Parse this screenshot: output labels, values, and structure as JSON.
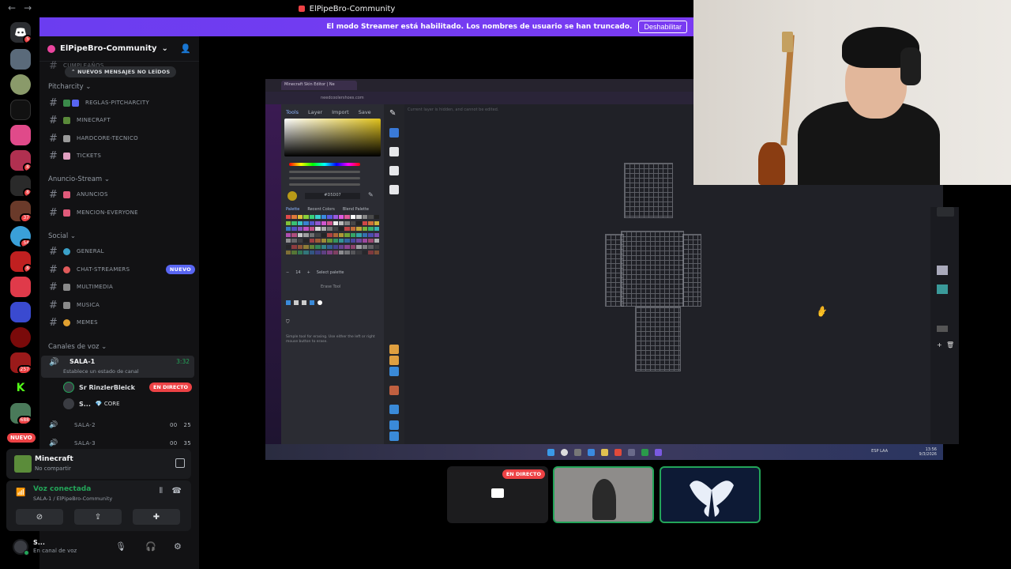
{
  "window": {
    "title": "ElPipeBro-Community",
    "back_glyph": "←",
    "fwd_glyph": "→"
  },
  "banner": {
    "text": "El modo Streamer está habilitado. Los nombres de usuario se han truncado.",
    "button": "Deshabilitar"
  },
  "rail": {
    "badges": [
      "5",
      "8",
      "8",
      "37",
      "54",
      "8",
      "257",
      "688"
    ],
    "nuevo": "NUEVO",
    "discord_icon": "discord-logo-icon"
  },
  "guild": {
    "name": "ElPipeBro-Community"
  },
  "unread_pill": "NUEVOS MENSAJES NO LEÍDOS",
  "partial_top_channel": "CUMPLEAÑOS",
  "categories": {
    "pitcharcity": "Pitcharcity",
    "anuncio": "Anuncio-Stream",
    "social": "Social",
    "voz": "Canales de voz"
  },
  "channels": {
    "reglas": "REGLAS-PITCHARCITY",
    "minecraft": "MINECRAFT",
    "hardcore": "HARDCORE-TECNICO",
    "tickets": "TICKETS",
    "anuncios": "ANUNCIOS",
    "mencion": "MENCION-EVERYONE",
    "general": "GENERAL",
    "chat": "CHAT-STREAMERS",
    "multimedia": "MULTIMEDIA",
    "musica": "MUSICA",
    "memes": "MEMES"
  },
  "new_badge": "NUEVO",
  "voice": {
    "sala1": {
      "name": "SALA-1",
      "time": "3:32",
      "status": "Establece un estado de canal"
    },
    "user1": {
      "name": "Sr RinzlerBleick",
      "live": "EN DIRECTO"
    },
    "user2": {
      "name": "S...",
      "tag": "CORE"
    },
    "sala2": {
      "name": "SALA-2",
      "a": "00",
      "b": "25"
    },
    "sala3": {
      "name": "SALA-3",
      "a": "00",
      "b": "35"
    }
  },
  "activity": {
    "game": "Minecraft",
    "sub": "No compartir"
  },
  "voice_panel": {
    "title": "Voz conectada",
    "sub": "SALA-1 / ElPipeBro-Community"
  },
  "user": {
    "name": "S...",
    "status": "En canal de voz"
  },
  "editor": {
    "tab_title": "Minecraft Skin Editor | Ne",
    "url": "needcoolershoes.com",
    "tabs": [
      "Tools",
      "Layer",
      "Import",
      "Save"
    ],
    "hex": "#D5D07",
    "palette_tabs": [
      "Palette",
      "Recent Colors",
      "Blend Palette"
    ],
    "brush_size": "14",
    "select_palette": "Select palette",
    "erase_tool": "Erase Tool",
    "help": "Simple tool for erasing. Use either the left or right mouse button to erase.",
    "hint": "Current layer is hidden, and cannot be edited.",
    "time": "13:56",
    "date": "9/3/2026",
    "locale": "ESP LAA"
  },
  "tiles": {
    "live": "EN DIRECTO"
  },
  "colors": {
    "accent": "#5865f2",
    "live": "#ed4245",
    "green": "#23a559",
    "banner": "#6b3df0"
  }
}
